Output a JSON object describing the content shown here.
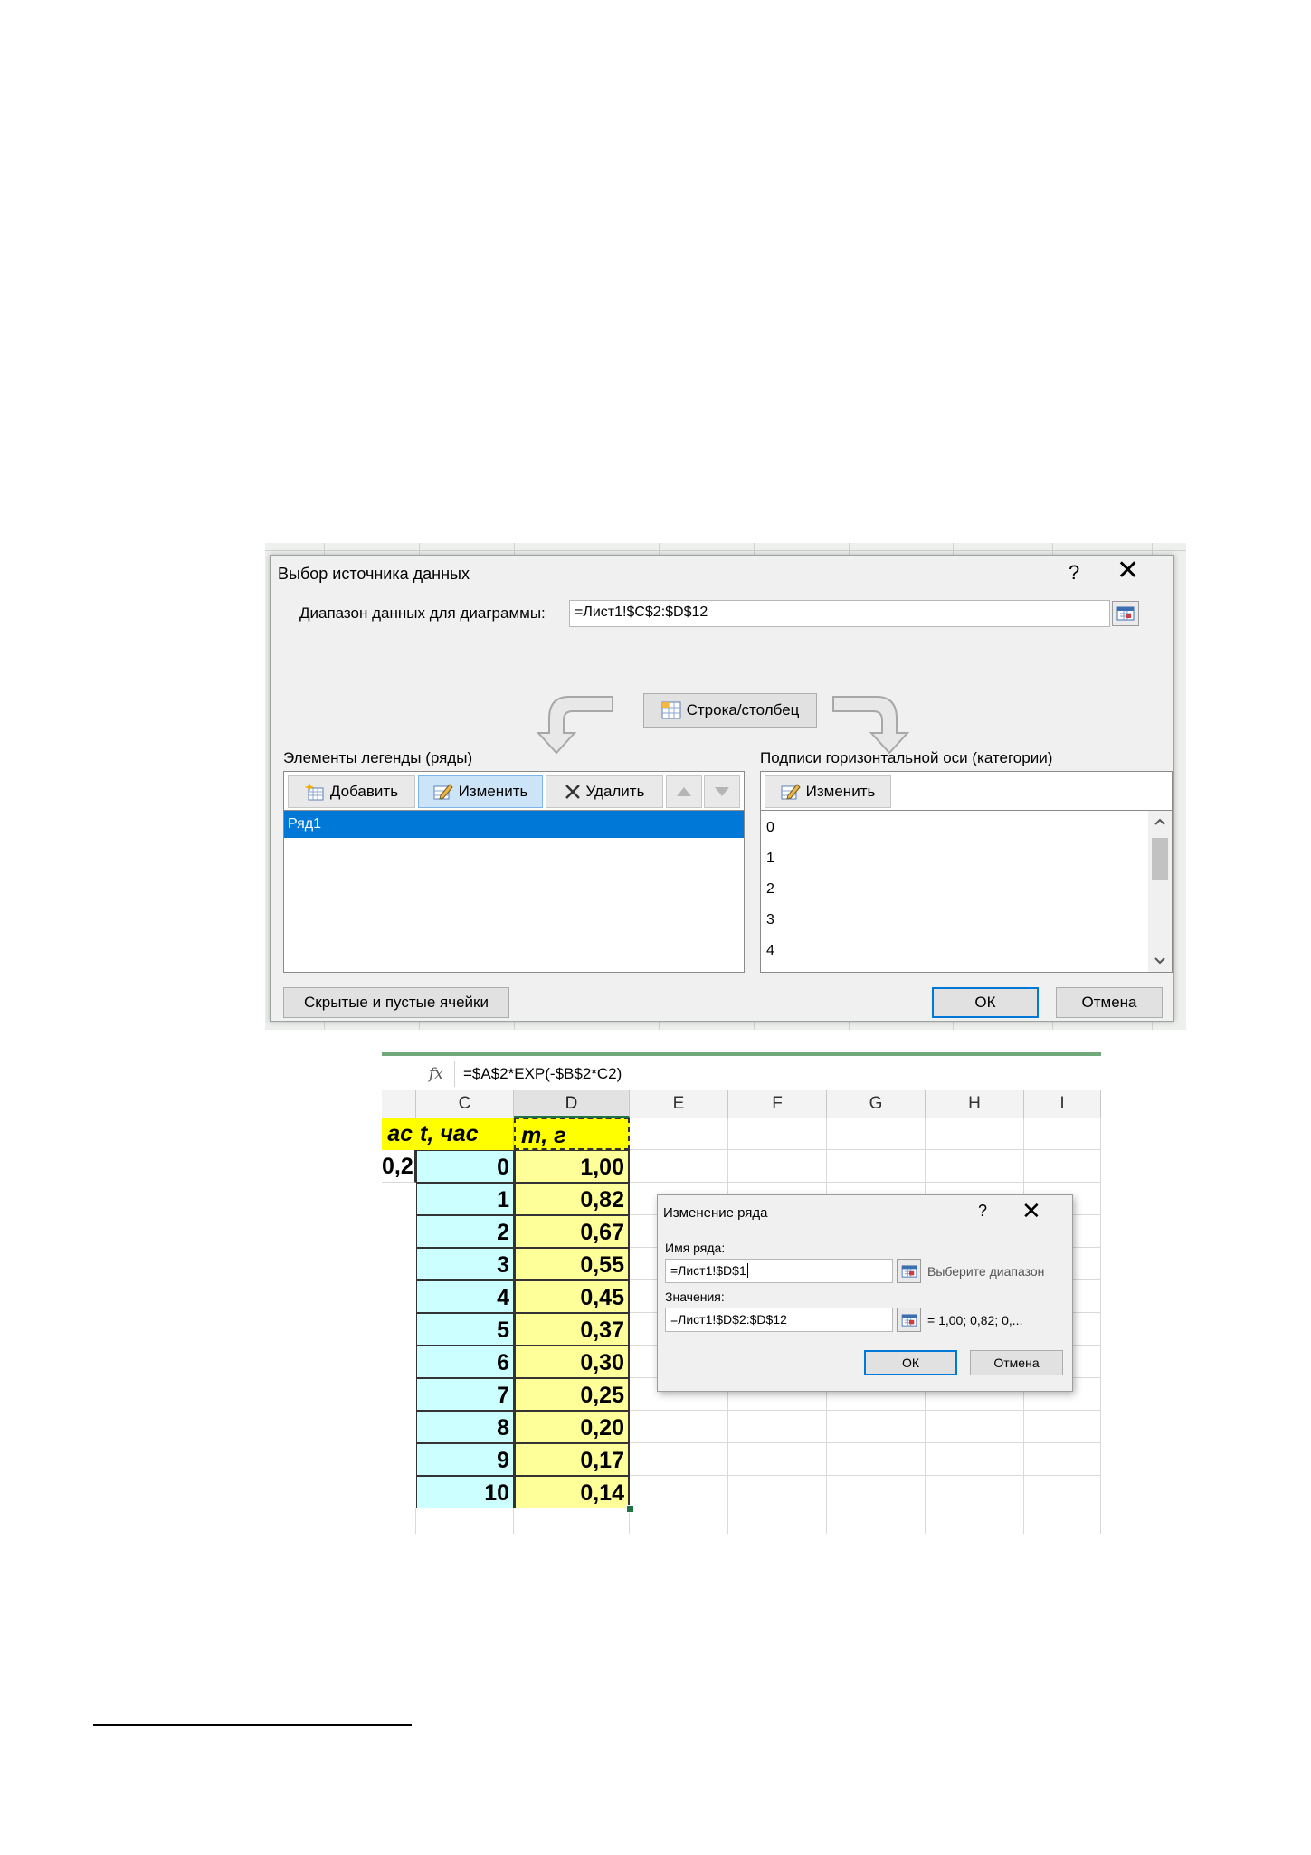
{
  "select_source_dialog": {
    "title": "Выбор источника данных",
    "help": "?",
    "close": "✕",
    "range_label": "Диапазон данных для диаграммы:",
    "range_value": "=Лист1!$C$2:$D$12",
    "switch_label": "Строка/столбец",
    "legend_label": "Элементы легенды (ряды)",
    "add_label": "Добавить",
    "edit_label": "Изменить",
    "delete_label": "Удалить",
    "series": [
      "Ряд1"
    ],
    "axis_label": "Подписи горизонтальной оси (категории)",
    "axis_edit_label": "Изменить",
    "categories": [
      "0",
      "1",
      "2",
      "3",
      "4"
    ],
    "hidden_cells_label": "Скрытые и пустые ячейки",
    "ok_label": "ОК",
    "cancel_label": "Отмена"
  },
  "sheet": {
    "fx": "fx",
    "formula": "=$A$2*EXP(-$B$2*C2)",
    "columns": [
      "C",
      "D",
      "E",
      "F",
      "G",
      "H",
      "I"
    ],
    "partial_header": "ас",
    "partial_value": "0,2",
    "header_c": "t, час",
    "header_d": "m, г",
    "rows": [
      {
        "t": "0",
        "m": "1,00"
      },
      {
        "t": "1",
        "m": "0,82"
      },
      {
        "t": "2",
        "m": "0,67"
      },
      {
        "t": "3",
        "m": "0,55"
      },
      {
        "t": "4",
        "m": "0,45"
      },
      {
        "t": "5",
        "m": "0,37"
      },
      {
        "t": "6",
        "m": "0,30"
      },
      {
        "t": "7",
        "m": "0,25"
      },
      {
        "t": "8",
        "m": "0,20"
      },
      {
        "t": "9",
        "m": "0,17"
      },
      {
        "t": "10",
        "m": "0,14"
      }
    ]
  },
  "edit_series_dialog": {
    "title": "Изменение ряда",
    "help": "?",
    "close": "✕",
    "name_label": "Имя ряда:",
    "name_value": "=Лист1!$D$1",
    "name_hint": "Выберите диапазон",
    "values_label": "Значения:",
    "values_value": "=Лист1!$D$2:$D$12",
    "values_preview": "= 1,00; 0,82; 0,...",
    "ok_label": "ОК",
    "cancel_label": "Отмена"
  },
  "colors": {
    "selection_blue": "#0078d7",
    "cell_yellow": "#ffff99",
    "header_yellow": "#ffff00",
    "cell_cyan": "#ccffff"
  }
}
